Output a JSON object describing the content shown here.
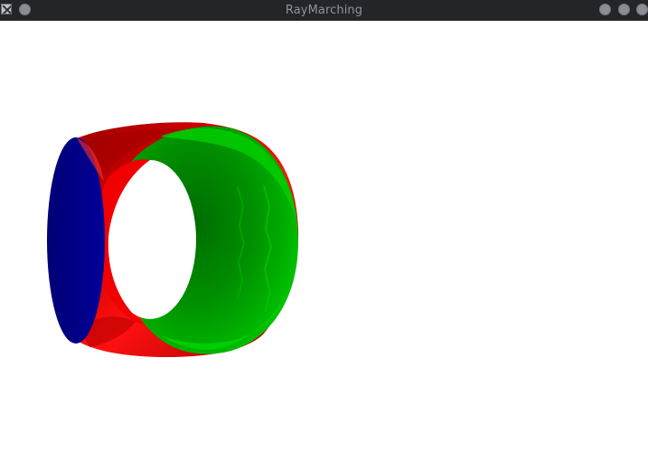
{
  "window": {
    "title": "RayMarching"
  },
  "titlebar": {
    "icons": {
      "app": "x-window-icon",
      "pin": "sticky-pin-icon",
      "minimize": "minimize-icon",
      "maximize": "maximize-icon",
      "close": "close-icon"
    }
  },
  "scene": {
    "background": "#ffffff",
    "colors": {
      "blue_cap": "#00008b",
      "red_body": "#cc0000",
      "green_face": "#00b800",
      "green_dark": "#007800",
      "green_light": "#00dd00"
    }
  }
}
